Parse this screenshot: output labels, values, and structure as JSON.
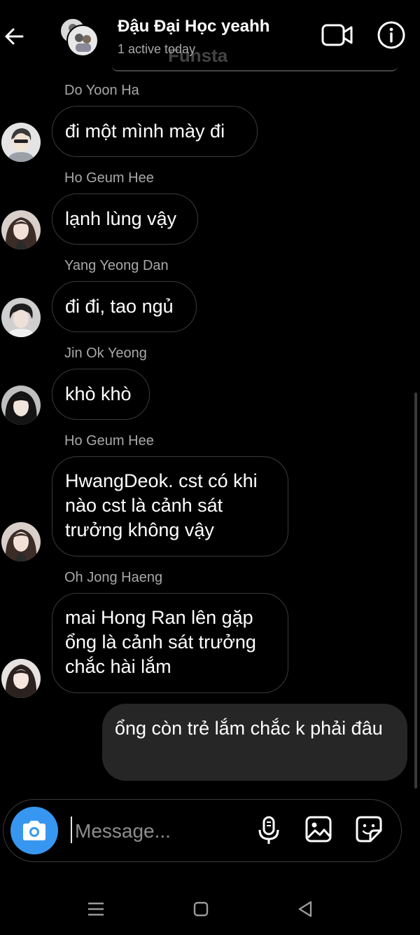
{
  "header": {
    "title": "Đậu Đại Học yeahh",
    "status": "1 active today",
    "obscured_label": "Funsta"
  },
  "messages": [
    {
      "sender": "Do Yoon Ha",
      "text": "đi một mình mày đi"
    },
    {
      "sender": "Ho Geum Hee",
      "text": "lạnh lùng vậy"
    },
    {
      "sender": "Yang Yeong Dan",
      "text": "đi đi, tao ngủ"
    },
    {
      "sender": "Jin Ok Yeong",
      "text": "khò khò"
    },
    {
      "sender": "Ho Geum Hee",
      "text": "HwangDeok. cst có khi nào cst là cảnh sát trưởng không vậy"
    },
    {
      "sender": "Oh Jong Haeng",
      "text": "mai Hong Ran lên gặp ổng là cảnh sát trưởng chắc hài lắm"
    }
  ],
  "my_message": {
    "text": "ổng còn trẻ lắm chắc k phải đâu"
  },
  "composer": {
    "placeholder": "Message..."
  },
  "icons": {
    "back": "arrow-left-icon",
    "video": "video-camera-icon",
    "info": "info-icon",
    "camera": "camera-icon",
    "mic": "microphone-icon",
    "gallery": "image-icon",
    "sticker": "sticker-icon"
  },
  "colors": {
    "accent": "#3797f0",
    "background": "#000000",
    "bubble_border": "#3a3a3a",
    "my_bubble": "#262626"
  }
}
